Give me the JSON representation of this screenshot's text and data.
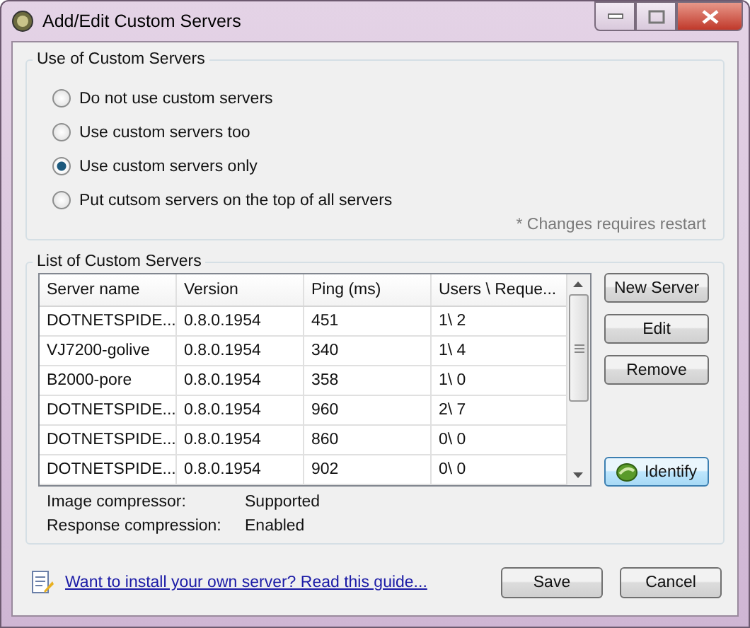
{
  "window": {
    "title": "Add/Edit Custom Servers"
  },
  "usage_group": {
    "title": "Use of Custom Servers",
    "options": [
      {
        "label": "Do not use custom servers",
        "selected": false
      },
      {
        "label": "Use custom servers too",
        "selected": false
      },
      {
        "label": "Use custom servers only",
        "selected": true
      },
      {
        "label": "Put cutsom servers on the top of all servers",
        "selected": false
      }
    ],
    "note": "* Changes requires restart"
  },
  "servers_group": {
    "title": "List of Custom Servers",
    "table": {
      "columns": [
        "Server name",
        "Version",
        "Ping (ms)",
        "Users \\ Reque..."
      ],
      "rows": [
        [
          "DOTNETSPIDE...",
          "0.8.0.1954",
          "451",
          "1\\ 2"
        ],
        [
          "VJ7200-golive",
          "0.8.0.1954",
          "340",
          "1\\ 4"
        ],
        [
          "B2000-pore",
          "0.8.0.1954",
          "358",
          "1\\ 0"
        ],
        [
          "DOTNETSPIDE...",
          "0.8.0.1954",
          "960",
          "2\\ 7"
        ],
        [
          "DOTNETSPIDE...",
          "0.8.0.1954",
          "860",
          "0\\ 0"
        ],
        [
          "DOTNETSPIDE...",
          "0.8.0.1954",
          "902",
          "0\\ 0"
        ]
      ]
    },
    "buttons": [
      "New Server",
      "Edit",
      "Remove"
    ],
    "identify_button": "Identify",
    "info": [
      {
        "label": "Image compressor:",
        "value": "Supported"
      },
      {
        "label": "Response compression:",
        "value": "Enabled"
      }
    ]
  },
  "guide_link": "Want to install your own server? Read this guide...",
  "buttons": [
    "Save",
    "Cancel"
  ]
}
